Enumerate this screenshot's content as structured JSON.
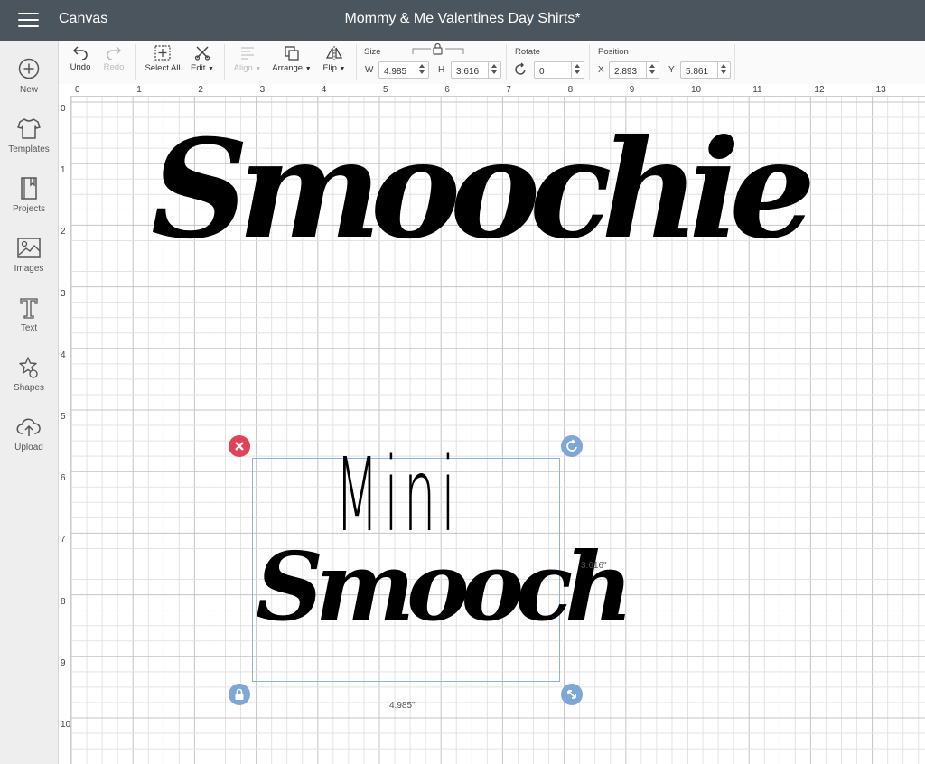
{
  "header": {
    "app_name": "Canvas",
    "document_title": "Mommy & Me Valentines Day Shirts*"
  },
  "sidebar": {
    "items": [
      {
        "label": "New",
        "icon": "plus-circle-icon"
      },
      {
        "label": "Templates",
        "icon": "tshirt-icon"
      },
      {
        "label": "Projects",
        "icon": "notebook-icon"
      },
      {
        "label": "Images",
        "icon": "image-icon"
      },
      {
        "label": "Text",
        "icon": "text-icon"
      },
      {
        "label": "Shapes",
        "icon": "shapes-icon"
      },
      {
        "label": "Upload",
        "icon": "cloud-upload-icon"
      }
    ]
  },
  "toolbar": {
    "undo_label": "Undo",
    "redo_label": "Redo",
    "select_all_label": "Select All",
    "edit_label": "Edit",
    "align_label": "Align",
    "arrange_label": "Arrange",
    "flip_label": "Flip",
    "size": {
      "title": "Size",
      "w_letter": "W",
      "h_letter": "H",
      "width": "4.985",
      "height": "3.616"
    },
    "rotate": {
      "title": "Rotate",
      "value": "0"
    },
    "position": {
      "title": "Position",
      "x_letter": "X",
      "y_letter": "Y",
      "x": "2.893",
      "y": "5.861"
    }
  },
  "rulers": {
    "top": [
      "0",
      "1",
      "2",
      "3",
      "4",
      "5",
      "6",
      "7",
      "8",
      "9",
      "10",
      "11",
      "12",
      "13"
    ],
    "left": [
      "0",
      "1",
      "2",
      "3",
      "4",
      "5",
      "6",
      "7",
      "8",
      "9",
      "10"
    ]
  },
  "canvas": {
    "text_top": "Smoochie",
    "text_mini": "Mini",
    "text_bottom": "Smooch",
    "width_label": "4.985\"",
    "height_label": "3.616\""
  },
  "colors": {
    "header": "#4b555e",
    "selection": "#8fb3d9",
    "delete_handle": "#e04357",
    "blue_handle": "#7fa7d6"
  }
}
